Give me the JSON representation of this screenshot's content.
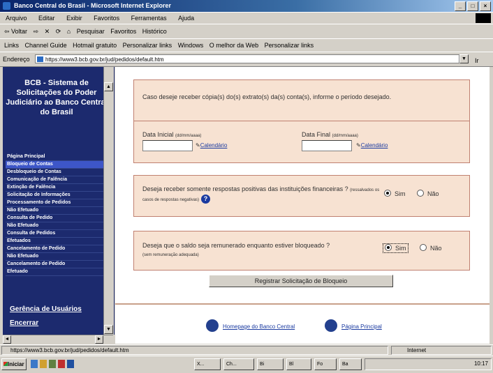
{
  "window": {
    "title": "Banco Central do Brasil - Microsoft Internet Explorer",
    "controls": [
      "_",
      "□",
      "×"
    ]
  },
  "menubar": [
    "Arquivo",
    "Editar",
    "Exibir",
    "Favoritos",
    "Ferramentas",
    "Ajuda"
  ],
  "toolbar": [
    "⇦ Voltar",
    "⇨",
    "✕",
    "⟳",
    "⌂",
    "Pesquisar",
    "Favoritos",
    "Histórico"
  ],
  "linksbar": [
    "Links",
    "Channel Guide",
    "Hotmail gratuito",
    "Personalizar links",
    "Windows",
    "O melhor da Web",
    "Personalizar links"
  ],
  "address": {
    "label": "Endereço",
    "url": "https://www3.bcb.gov.br/jud/pedidos/default.htm",
    "go": "Ir"
  },
  "sidebar": {
    "title": "BCB - Sistema de Solicitações do Poder Judiciário ao Banco Central do Brasil",
    "items": [
      "Página Principal",
      "Bloqueio de Contas",
      "Desbloqueio de Contas",
      "Comunicação de Falência",
      "Extinção de Falência",
      "Solicitação de Informações",
      "Processamento de Pedidos",
      "Não Efetuado",
      "Consulta de Pedido",
      "Não Efetuado",
      "Consulta de Pedidos",
      "Efetuados",
      "Cancelamento de Pedido",
      "Não Efetuado",
      "Cancelamento de Pedido",
      "Efetuado"
    ],
    "selected_index": 1,
    "users_link": "Gerência de Usuários",
    "exit_link": "Encerrar"
  },
  "form": {
    "intro": "Caso deseje receber cópia(s) do(s) extrato(s) da(s) conta(s), informe o período desejado.",
    "start_label": "Data Inicial",
    "end_label": "Data Final",
    "date_format": "(dd/mm/aaaa)",
    "calendar_label": "Calendário",
    "q1": "Deseja receber somente respostas positivas das instituições financeiras ?",
    "q1_note": "(ressalvados os casos de respostas negativas)",
    "q2": "Deseja que o saldo seja remunerado enquanto estiver bloqueado ?",
    "q2_note": "(sem remuneração adequada)",
    "yes": "Sim",
    "no": "Não",
    "q1_selected": "Sim",
    "q2_selected": "Sim",
    "submit": "Registrar Solicitação de Bloqueio"
  },
  "footer": {
    "home_link": "Homepage do Banco Central",
    "main_link": "Página Principal"
  },
  "status": {
    "url": "https://www3.bcb.gov.br/jud/pedidos/default.htm",
    "zone": "Internet"
  },
  "taskbar": {
    "start": "Iniciar",
    "tasks": [
      "X...",
      "Ch...",
      "Bi",
      "Bl",
      "Fo",
      "Ba"
    ],
    "clock": "10:17"
  },
  "colors": {
    "panel": "#f7e2d2",
    "sidebar": "#1c2a6e",
    "link": "#1a3aa0"
  }
}
